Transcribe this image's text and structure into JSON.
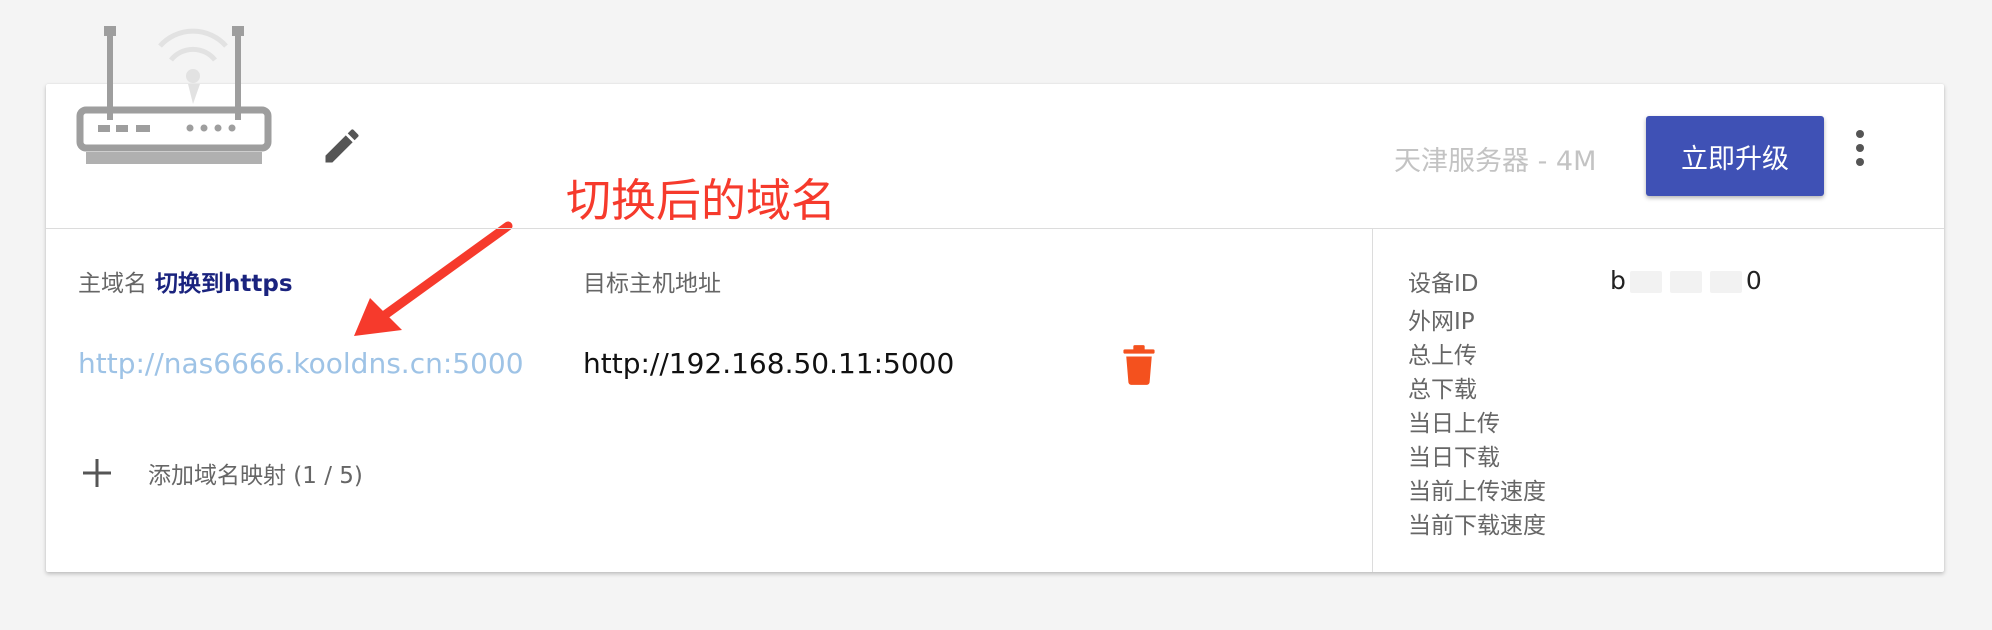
{
  "header": {
    "server_label": "天津服务器 - 4M",
    "upgrade_button": "立即升级"
  },
  "annotation": {
    "text": "切换后的域名",
    "color": "#f63a2c"
  },
  "mapping": {
    "main_domain_header": "主域名",
    "https_link": "切换到https",
    "target_header": "目标主机地址",
    "rows": [
      {
        "domain": "http://nas6666.kooldns.cn:5000",
        "target": "http://192.168.50.11:5000"
      }
    ],
    "add_label": "添加域名映射 (1 / 5)"
  },
  "stats": {
    "device_id_label": "设备ID",
    "device_id_start": "b",
    "device_id_end": "0",
    "labels": [
      "外网IP",
      "总上传",
      "总下载",
      "当日上传",
      "当日下载",
      "当前上传速度",
      "当前下载速度"
    ]
  },
  "colors": {
    "primary": "#3f51b5",
    "link": "#9ec3e6",
    "https": "#1a237e",
    "delete": "#f4511e"
  },
  "icons": [
    "router-icon",
    "edit-icon",
    "more-vert-icon",
    "arrow-icon",
    "delete-icon",
    "plus-icon"
  ]
}
